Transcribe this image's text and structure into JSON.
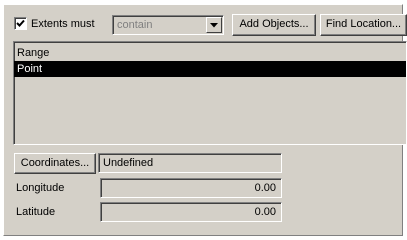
{
  "extents": {
    "checkbox_label": "Extents must",
    "checked": true,
    "mode_value": "contain"
  },
  "buttons": {
    "add_objects": "Add Objects...",
    "find_location": "Find Location...",
    "coordinates": "Coordinates..."
  },
  "list": {
    "items": [
      {
        "label": "Range",
        "selected": false
      },
      {
        "label": "Point",
        "selected": true
      }
    ]
  },
  "coordinates": {
    "value": "Undefined",
    "longitude_label": "Longitude",
    "longitude_value": "0.00",
    "latitude_label": "Latitude",
    "latitude_value": "0.00"
  },
  "icons": {
    "checkbox": "check-icon",
    "dropdown": "chevron-down-icon"
  }
}
